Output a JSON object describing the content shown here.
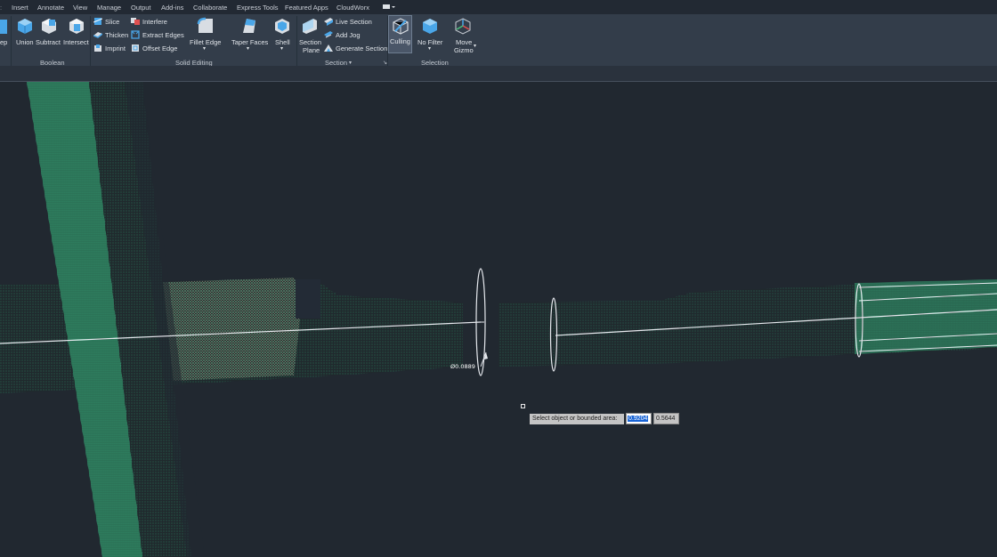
{
  "menubar": {
    "items": [
      "Insert",
      "Annotate",
      "View",
      "Manage",
      "Output",
      "Add-ins",
      "Collaborate",
      "Express Tools",
      "Featured Apps",
      "CloudWorx"
    ]
  },
  "ribbon": {
    "cut_label": "ep",
    "boolean": {
      "title": "Boolean",
      "buttons": [
        "Union",
        "Subtract",
        "Intersect"
      ]
    },
    "solid_editing": {
      "title": "Solid Editing",
      "small_buttons": [
        "Slice",
        "Thicken",
        "Imprint",
        "Interfere",
        "Extract Edges",
        "Offset Edge"
      ],
      "big_buttons": [
        "Fillet Edge",
        "Taper Faces",
        "Shell"
      ]
    },
    "section": {
      "title": "Section",
      "section_plane": [
        "Section",
        "Plane"
      ],
      "small_buttons": [
        "Live Section",
        "Add Jog",
        "Generate Section"
      ]
    },
    "selection": {
      "title": "Selection",
      "buttons": [
        "Culling",
        "No Filter"
      ],
      "move_gizmo": [
        "Move",
        "Gizmo"
      ]
    }
  },
  "viewport": {
    "dimension_label": "Ø0.0889"
  },
  "command": {
    "prompt": "Select object or bounded area:",
    "x_value": "0.9204",
    "y_value": "0.5644"
  },
  "colors": {
    "pointcloud": "#2fb583",
    "pointcloud_light": "#8fd8b0",
    "background": "#212830",
    "ribbon": "#333d4a"
  }
}
